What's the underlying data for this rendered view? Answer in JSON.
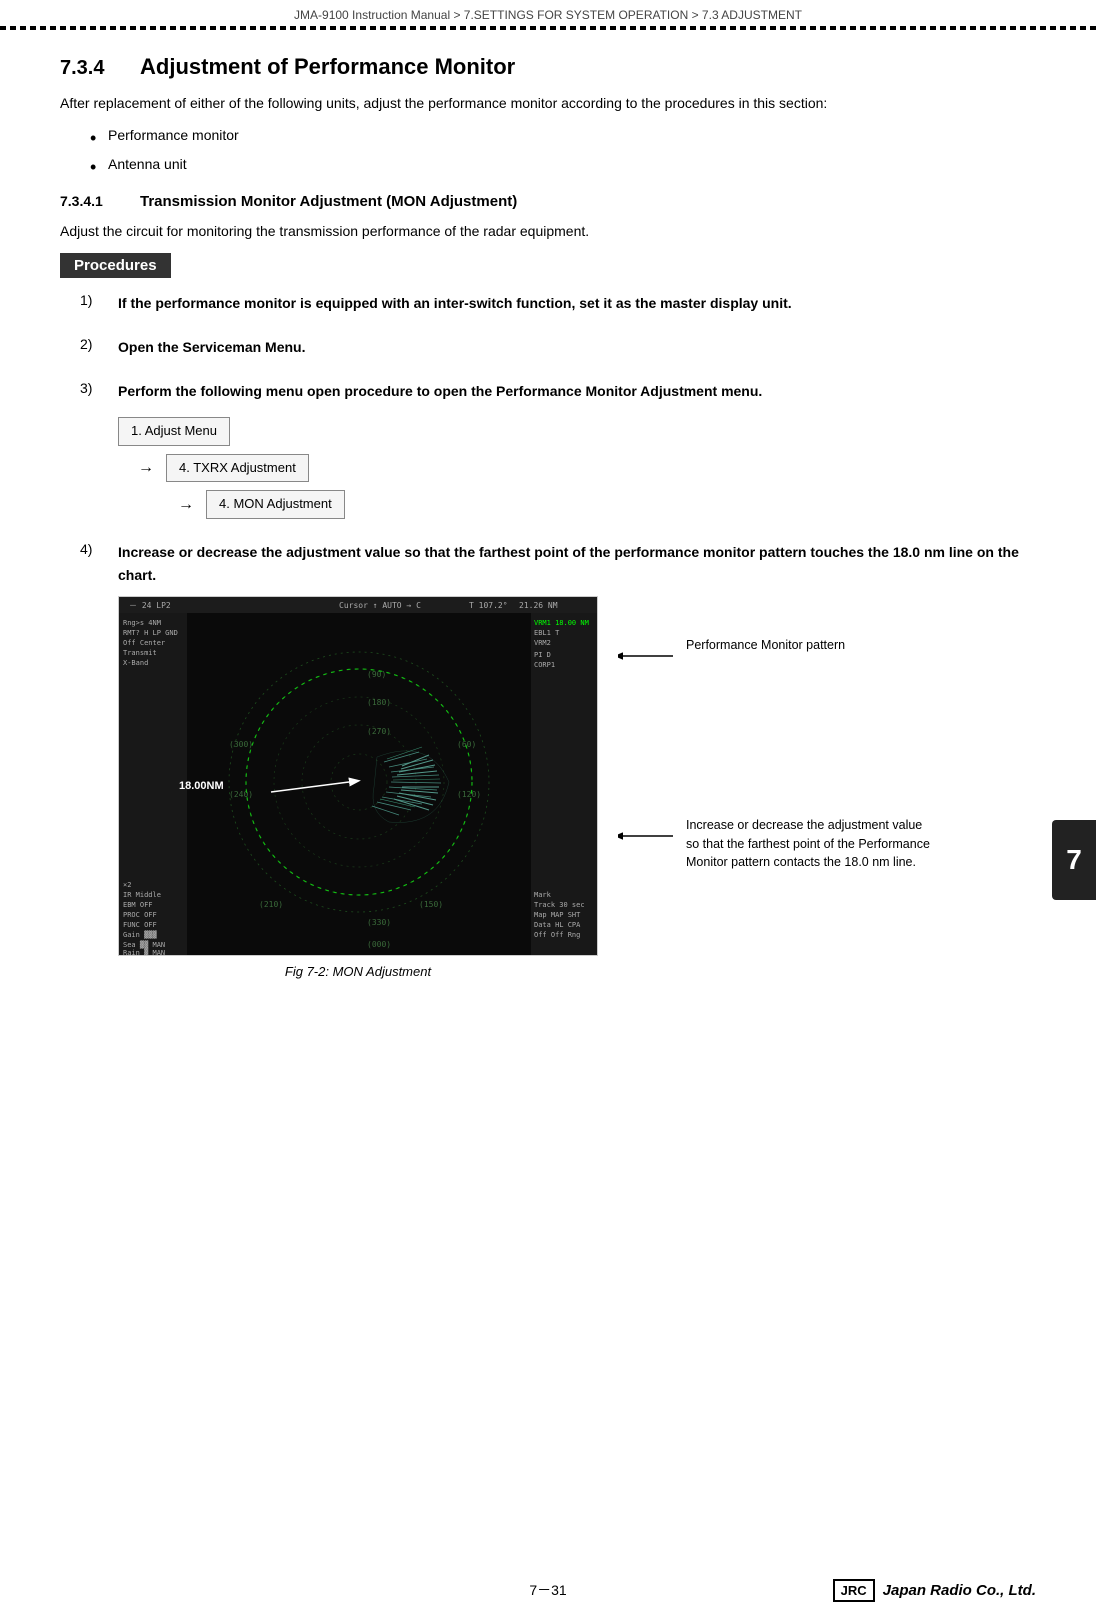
{
  "header": {
    "breadcrumb": "JMA-9100 Instruction Manual  >  7.SETTINGS FOR SYSTEM OPERATION  >  7.3  ADJUSTMENT"
  },
  "section": {
    "number": "7.3.4",
    "title": "Adjustment of Performance Monitor",
    "intro": "After replacement of either of the following units, adjust the performance monitor according to the procedures in this section:",
    "bullets": [
      "Performance monitor",
      "Antenna unit"
    ]
  },
  "subsection": {
    "number": "7.3.4.1",
    "title": "Transmission Monitor Adjustment (MON Adjustment)",
    "description": "Adjust the circuit for monitoring the transmission performance of the radar equipment."
  },
  "procedures_label": "Procedures",
  "steps": [
    {
      "number": "1)",
      "text": "If the performance monitor is equipped with an inter-switch function, set it as the master display unit."
    },
    {
      "number": "2)",
      "text": "Open the Serviceman Menu."
    },
    {
      "number": "3)",
      "text": "Perform the following menu open procedure to open the Performance Monitor Adjustment menu.",
      "menu": [
        {
          "label": "1. Adjust Menu",
          "arrow": false
        },
        {
          "label": "4. TXRX Adjustment",
          "arrow": true
        },
        {
          "label": "4. MON Adjustment",
          "arrow": true
        }
      ]
    },
    {
      "number": "4)",
      "text": "Increase or decrease the adjustment value so that the farthest point of the performance monitor pattern touches the 18.0 nm line on the chart."
    }
  ],
  "radar_image": {
    "top_left_text": "24",
    "nm_label": "18.00NM",
    "caption": "Fig 7-2: MON Adjustment"
  },
  "annotations": [
    {
      "id": "perf_monitor_pattern",
      "text": "Performance Monitor pattern"
    },
    {
      "id": "adjustment_note",
      "text": "Increase or decrease the adjustment value so that the farthest point of the Performance Monitor pattern contacts the 18.0 nm line."
    }
  ],
  "side_tab": {
    "label": "7"
  },
  "footer": {
    "page": "7－31",
    "jrc_label": "JRC",
    "company": "Japan Radio Co., Ltd."
  }
}
